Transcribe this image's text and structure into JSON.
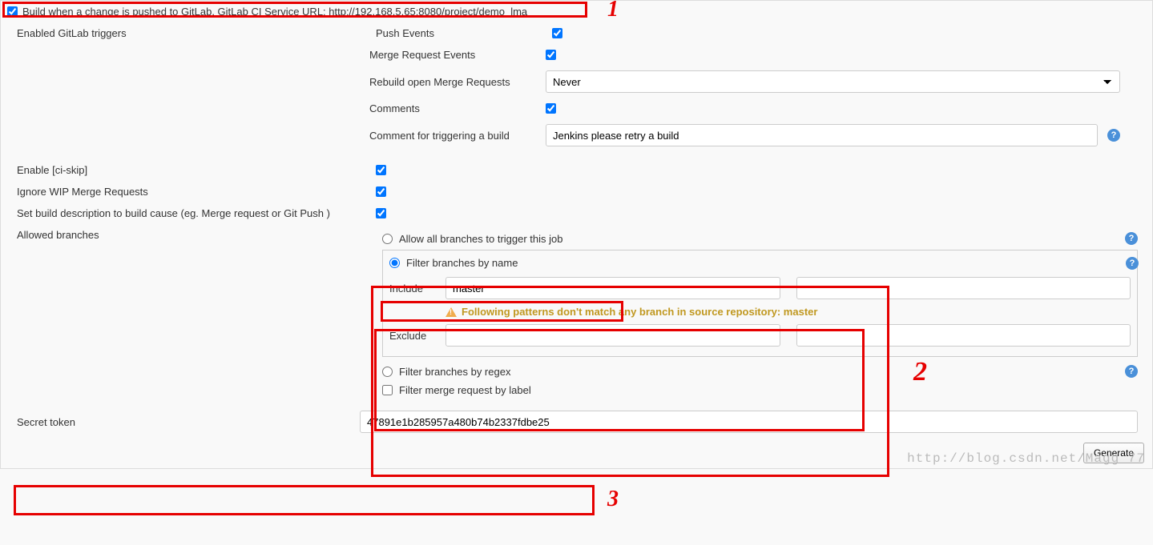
{
  "topCheckbox": {
    "checked": true,
    "label": "Build when a change is pushed to GitLab. GitLab CI Service URL: http://192.168.5.65:8080/project/demo_lma"
  },
  "triggersLabel": "Enabled GitLab triggers",
  "triggers": {
    "push": {
      "label": "Push Events",
      "checked": true
    },
    "mergeReq": {
      "label": "Merge Request Events",
      "checked": true
    },
    "rebuildOpenMR": {
      "label": "Rebuild open Merge Requests",
      "value": "Never"
    },
    "comments": {
      "label": "Comments",
      "checked": true
    },
    "commentTrigger": {
      "label": "Comment for triggering a build",
      "value": "Jenkins please retry a build"
    }
  },
  "ciSkip": {
    "label": "Enable [ci-skip]",
    "checked": true
  },
  "ignoreWip": {
    "label": "Ignore WIP Merge Requests",
    "checked": true
  },
  "buildDesc": {
    "label": "Set build description to build cause (eg. Merge request or Git Push )",
    "checked": true
  },
  "allowedBranches": {
    "label": "Allowed branches",
    "allowAll": {
      "label": "Allow all branches to trigger this job",
      "selected": false
    },
    "filterByName": {
      "label": "Filter branches by name",
      "selected": true,
      "includeLabel": "Include",
      "includeValue": "master",
      "warning": "Following patterns don't match any branch in source repository: master",
      "excludeLabel": "Exclude",
      "excludeValue": ""
    },
    "filterByRegex": {
      "label": "Filter branches by regex",
      "selected": false
    },
    "filterByLabel": {
      "label": "Filter merge request by label",
      "checked": false
    }
  },
  "secretToken": {
    "label": "Secret token",
    "value": "47891e1b285957a480b74b2337fdbe25",
    "button": "Generate"
  },
  "annotations": {
    "a1": "1",
    "a2": "2",
    "a3": "3"
  },
  "watermark": "http://blog.csdn.net/Magg      77"
}
